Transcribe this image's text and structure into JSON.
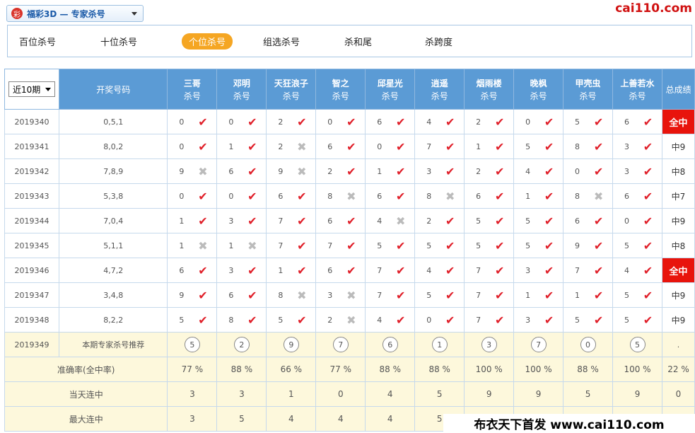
{
  "header": {
    "logo_glyph": "彩",
    "title": "福彩3D — 专家杀号",
    "brand": "cai110.com"
  },
  "tabs": [
    {
      "label": "百位杀号",
      "active": false
    },
    {
      "label": "十位杀号",
      "active": false
    },
    {
      "label": "个位杀号",
      "active": true
    },
    {
      "label": "组选杀号",
      "active": false
    },
    {
      "label": "杀和尾",
      "active": false
    },
    {
      "label": "杀跨度",
      "active": false
    }
  ],
  "table": {
    "period_select": "近10期",
    "col_draw": "开奖号码",
    "sub_label": "杀号",
    "col_total": "总成绩",
    "experts": [
      "三哥",
      "邓明",
      "天狂浪子",
      "智之",
      "邱星光",
      "逍遥",
      "烟雨楼",
      "晚枫",
      "甲壳虫",
      "上善若水"
    ],
    "rows": [
      {
        "period": "2019340",
        "draw": "0,5,1",
        "picks": [
          [
            "0",
            true
          ],
          [
            "0",
            true
          ],
          [
            "2",
            true
          ],
          [
            "0",
            true
          ],
          [
            "6",
            true
          ],
          [
            "4",
            true
          ],
          [
            "2",
            true
          ],
          [
            "0",
            true
          ],
          [
            "5",
            true
          ],
          [
            "6",
            true
          ]
        ],
        "total": "全中",
        "all": true
      },
      {
        "period": "2019341",
        "draw": "8,0,2",
        "picks": [
          [
            "0",
            true
          ],
          [
            "1",
            true
          ],
          [
            "2",
            false
          ],
          [
            "6",
            true
          ],
          [
            "0",
            true
          ],
          [
            "7",
            true
          ],
          [
            "1",
            true
          ],
          [
            "5",
            true
          ],
          [
            "8",
            true
          ],
          [
            "3",
            true
          ]
        ],
        "total": "中9",
        "all": false
      },
      {
        "period": "2019342",
        "draw": "7,8,9",
        "picks": [
          [
            "9",
            false
          ],
          [
            "6",
            true
          ],
          [
            "9",
            false
          ],
          [
            "2",
            true
          ],
          [
            "1",
            true
          ],
          [
            "3",
            true
          ],
          [
            "2",
            true
          ],
          [
            "4",
            true
          ],
          [
            "0",
            true
          ],
          [
            "3",
            true
          ]
        ],
        "total": "中8",
        "all": false
      },
      {
        "period": "2019343",
        "draw": "5,3,8",
        "picks": [
          [
            "0",
            true
          ],
          [
            "0",
            true
          ],
          [
            "6",
            true
          ],
          [
            "8",
            false
          ],
          [
            "6",
            true
          ],
          [
            "8",
            false
          ],
          [
            "6",
            true
          ],
          [
            "1",
            true
          ],
          [
            "8",
            false
          ],
          [
            "6",
            true
          ]
        ],
        "total": "中7",
        "all": false
      },
      {
        "period": "2019344",
        "draw": "7,0,4",
        "picks": [
          [
            "1",
            true
          ],
          [
            "3",
            true
          ],
          [
            "7",
            true
          ],
          [
            "6",
            true
          ],
          [
            "4",
            false
          ],
          [
            "2",
            true
          ],
          [
            "5",
            true
          ],
          [
            "5",
            true
          ],
          [
            "6",
            true
          ],
          [
            "0",
            true
          ]
        ],
        "total": "中9",
        "all": false
      },
      {
        "period": "2019345",
        "draw": "5,1,1",
        "picks": [
          [
            "1",
            false
          ],
          [
            "1",
            false
          ],
          [
            "7",
            true
          ],
          [
            "7",
            true
          ],
          [
            "5",
            true
          ],
          [
            "5",
            true
          ],
          [
            "5",
            true
          ],
          [
            "5",
            true
          ],
          [
            "9",
            true
          ],
          [
            "5",
            true
          ]
        ],
        "total": "中8",
        "all": false
      },
      {
        "period": "2019346",
        "draw": "4,7,2",
        "picks": [
          [
            "6",
            true
          ],
          [
            "3",
            true
          ],
          [
            "1",
            true
          ],
          [
            "6",
            true
          ],
          [
            "7",
            true
          ],
          [
            "4",
            true
          ],
          [
            "7",
            true
          ],
          [
            "3",
            true
          ],
          [
            "7",
            true
          ],
          [
            "4",
            true
          ]
        ],
        "total": "全中",
        "all": true
      },
      {
        "period": "2019347",
        "draw": "3,4,8",
        "picks": [
          [
            "9",
            true
          ],
          [
            "6",
            true
          ],
          [
            "8",
            false
          ],
          [
            "3",
            false
          ],
          [
            "7",
            true
          ],
          [
            "5",
            true
          ],
          [
            "7",
            true
          ],
          [
            "1",
            true
          ],
          [
            "1",
            true
          ],
          [
            "5",
            true
          ]
        ],
        "total": "中9",
        "all": false
      },
      {
        "period": "2019348",
        "draw": "8,2,2",
        "picks": [
          [
            "5",
            true
          ],
          [
            "8",
            true
          ],
          [
            "5",
            true
          ],
          [
            "2",
            false
          ],
          [
            "4",
            true
          ],
          [
            "0",
            true
          ],
          [
            "7",
            true
          ],
          [
            "3",
            true
          ],
          [
            "5",
            true
          ],
          [
            "5",
            true
          ]
        ],
        "total": "中9",
        "all": false
      }
    ],
    "recommend": {
      "period": "2019349",
      "label": "本期专家杀号推荐",
      "values": [
        "5",
        "2",
        "9",
        "7",
        "6",
        "1",
        "3",
        "7",
        "0",
        "5"
      ],
      "total": "."
    },
    "stats": [
      {
        "label": "准确率(全中率)",
        "values": [
          "77 %",
          "88 %",
          "66 %",
          "77 %",
          "88 %",
          "88 %",
          "100 %",
          "100 %",
          "88 %",
          "100 %"
        ],
        "total": "22 %"
      },
      {
        "label": "当天连中",
        "values": [
          "3",
          "3",
          "1",
          "0",
          "4",
          "5",
          "9",
          "9",
          "5",
          "9"
        ],
        "total": "0"
      },
      {
        "label": "最大连中",
        "values": [
          "3",
          "5",
          "4",
          "4",
          "4",
          "5",
          "",
          "",
          "",
          ""
        ],
        "total": ""
      }
    ]
  },
  "watermark": "布衣天下首发 www.cai110.com",
  "icons": {
    "hit": "check-icon",
    "miss": "cross-icon"
  },
  "colors": {
    "header_bg": "#5b9bd5",
    "hit": "#e0202a",
    "all_hit_bg": "#e8140c",
    "active_tab": "#f5a623",
    "footer_bg": "#fdf8dc"
  }
}
